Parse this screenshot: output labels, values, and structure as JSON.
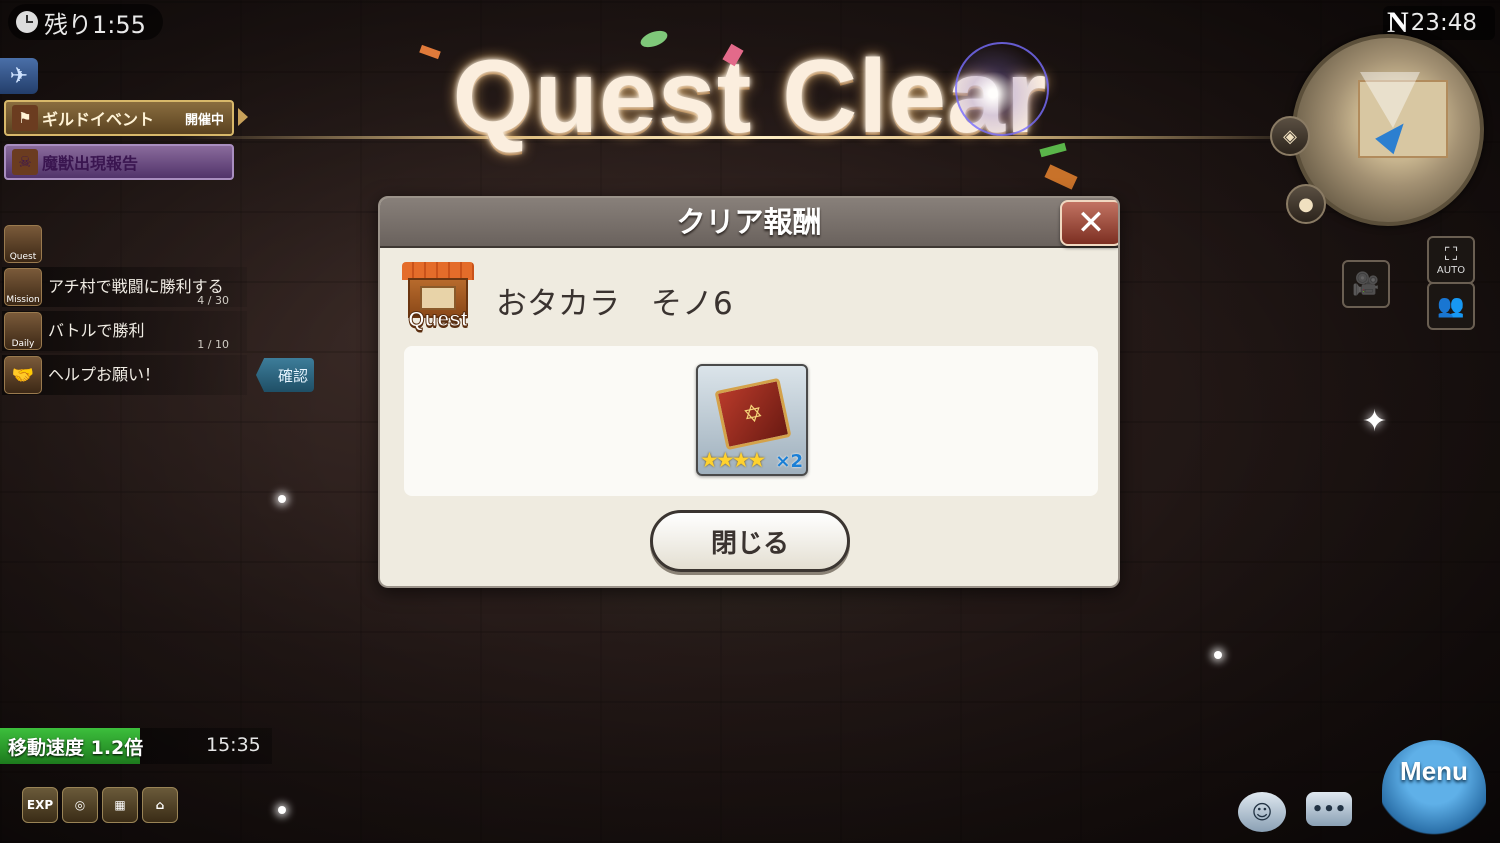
{
  "timer": {
    "remaining": "残り1:55"
  },
  "left_panel": {
    "guild_event": {
      "label": "ギルドイベント",
      "status": "開催中"
    },
    "beast_report": {
      "label": "魔獣出現報告"
    },
    "missions": [
      {
        "icon_label": "Quest",
        "text": "",
        "progress": ""
      },
      {
        "icon_label": "Mission",
        "text": "アチ村で戦闘に勝利する",
        "progress": "4 / 30"
      },
      {
        "icon_label": "Daily",
        "text": "バトルで勝利",
        "progress": "1 / 10"
      },
      {
        "icon_label": "",
        "text": "ヘルプお願い！",
        "progress": ""
      }
    ],
    "confirm_label": "確認"
  },
  "banner": {
    "title": "Quest Clear"
  },
  "dialog": {
    "title": "クリア報酬",
    "close_x": "✕",
    "quest_icon_label": "Quest",
    "quest_name": "おタカラ　そノ6",
    "reward": {
      "stars": "★★★★",
      "count": "×2"
    },
    "close_button": "閉じる"
  },
  "top_right": {
    "compass": "N",
    "clock": "23:48"
  },
  "side_buttons": {
    "auto_label": "AUTO"
  },
  "bottom_left": {
    "speed_label": "移動速度 1.2倍",
    "speed_time": "15:35",
    "buffs": [
      "EXP",
      "",
      "",
      ""
    ]
  },
  "bottom_right": {
    "menu_label": "Menu",
    "chat_label": "•••"
  }
}
